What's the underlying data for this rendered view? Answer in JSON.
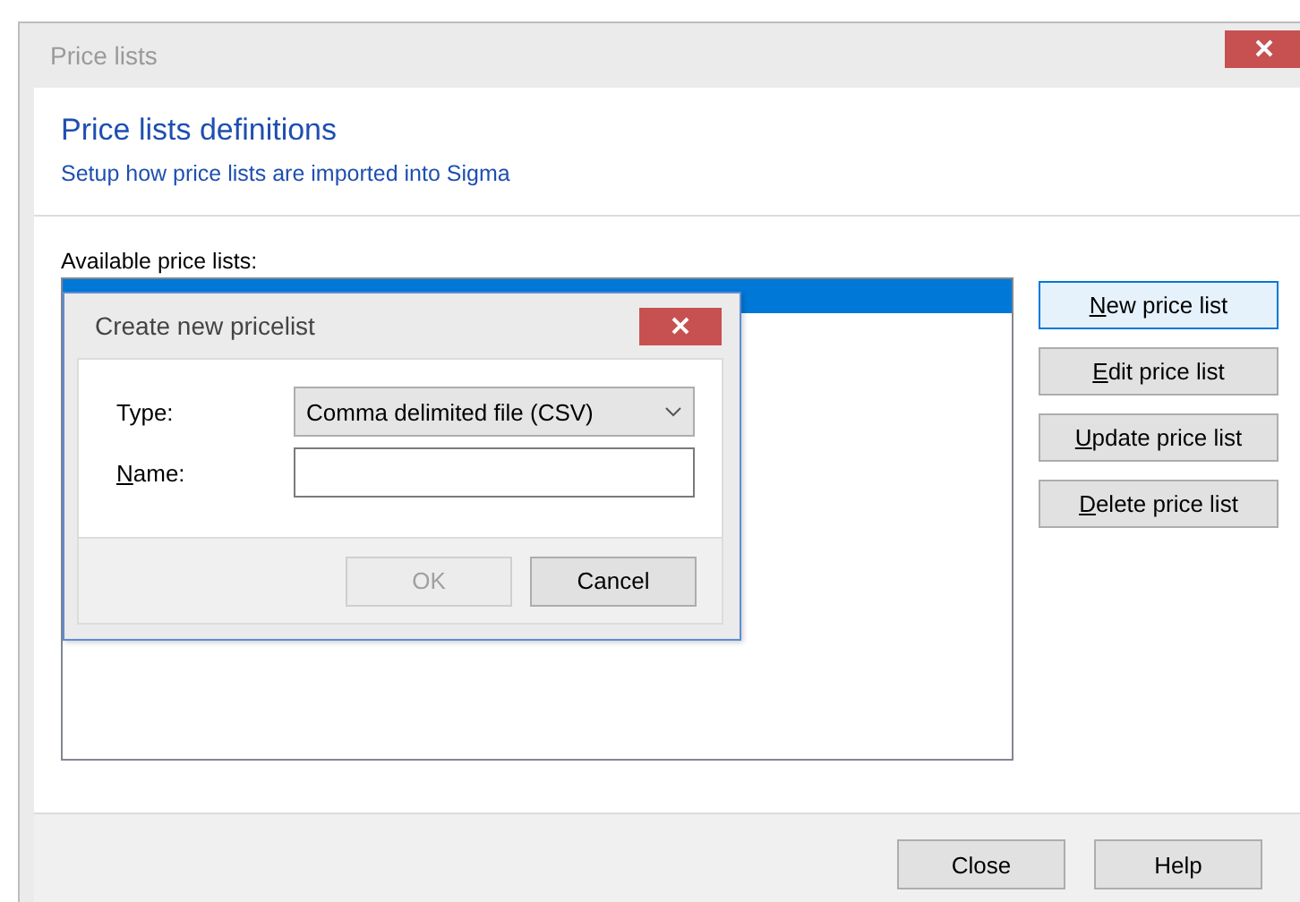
{
  "window": {
    "title": "Price lists"
  },
  "header": {
    "title": "Price lists definitions",
    "subtitle": "Setup how price lists are imported into Sigma"
  },
  "price_lists": {
    "label": "Available price lists:",
    "rows": [
      {
        "selected": true
      }
    ]
  },
  "side_buttons": [
    {
      "label": "New price list",
      "access_key": true,
      "focused": true
    },
    {
      "label": "Edit price list",
      "access_key": true,
      "focused": false
    },
    {
      "label": "Update price list",
      "access_key": true,
      "focused": false
    },
    {
      "label": "Delete price list",
      "access_key": true,
      "focused": false
    }
  ],
  "footer_buttons": [
    {
      "label": "Close",
      "disabled": false
    },
    {
      "label": "Help",
      "disabled": false
    }
  ],
  "dialog": {
    "title": "Create new pricelist",
    "type_field": {
      "label": "Type:",
      "access_key": false,
      "value": "Comma delimited file (CSV)"
    },
    "name_field": {
      "label": "Name:",
      "access_key": true
    },
    "buttons": [
      {
        "label": "OK",
        "disabled": true
      },
      {
        "label": "Cancel",
        "disabled": false
      }
    ]
  }
}
